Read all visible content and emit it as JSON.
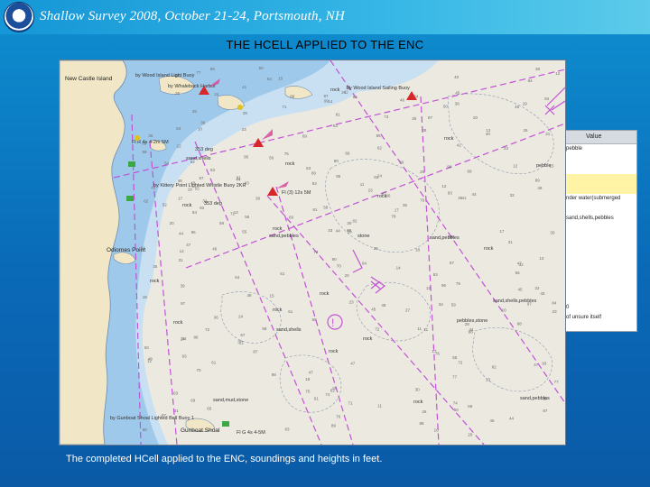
{
  "header": {
    "banner_title": "Shallow Survey 2008, October 21-24, Portsmouth, NH",
    "logo_icon": "noaa-logo-icon"
  },
  "slide": {
    "title": "THE  HCELL APPLIED TO THE ENC",
    "caption": "The completed HCell applied to the ENC, soundings and heights in feet."
  },
  "map": {
    "place_labels": [
      "New Castle Island",
      "Odiornes Point",
      "Gunboat Shoal"
    ],
    "feature_labels": [
      "by Wood Island Light Buoy",
      "by Whaleback Harbor",
      "by Wood Island Sailing Buoy",
      "Fl R 4s 4-2m 5M",
      "353 deg",
      "sand,shells",
      "by Kittery Point Lighted Whistle Buoy 2KR",
      "Fl (3) 12s 5M",
      "353 deg",
      "Fl G 4s 4-5M",
      "by Gunboat Shoal Lighted Bell Buoy 1",
      "sand,mud,stone",
      "sand,pebbles",
      "sand,shells,pebbles",
      "pebbles,stone",
      "sand,pebbles",
      "sand,shells",
      "stone",
      "sand,pebbles",
      "pebble"
    ],
    "rock_label": "rock",
    "palette": {
      "land": "#f1e7c6",
      "shallow_water": "#9fc9ea",
      "mid_water": "#c9e0f3",
      "deep_water": "#ece9e1",
      "route_line": "#c252d6",
      "depth_contour": "#8899aa"
    }
  },
  "side_panel": {
    "header": "Value",
    "rows": [
      "pebble",
      "",
      "",
      "",
      "",
      "nder water(submerged",
      "",
      "sand,shells,pebbles",
      "",
      "",
      "",
      "",
      "",
      "",
      "",
      "",
      "0",
      "of unsure itself"
    ]
  }
}
